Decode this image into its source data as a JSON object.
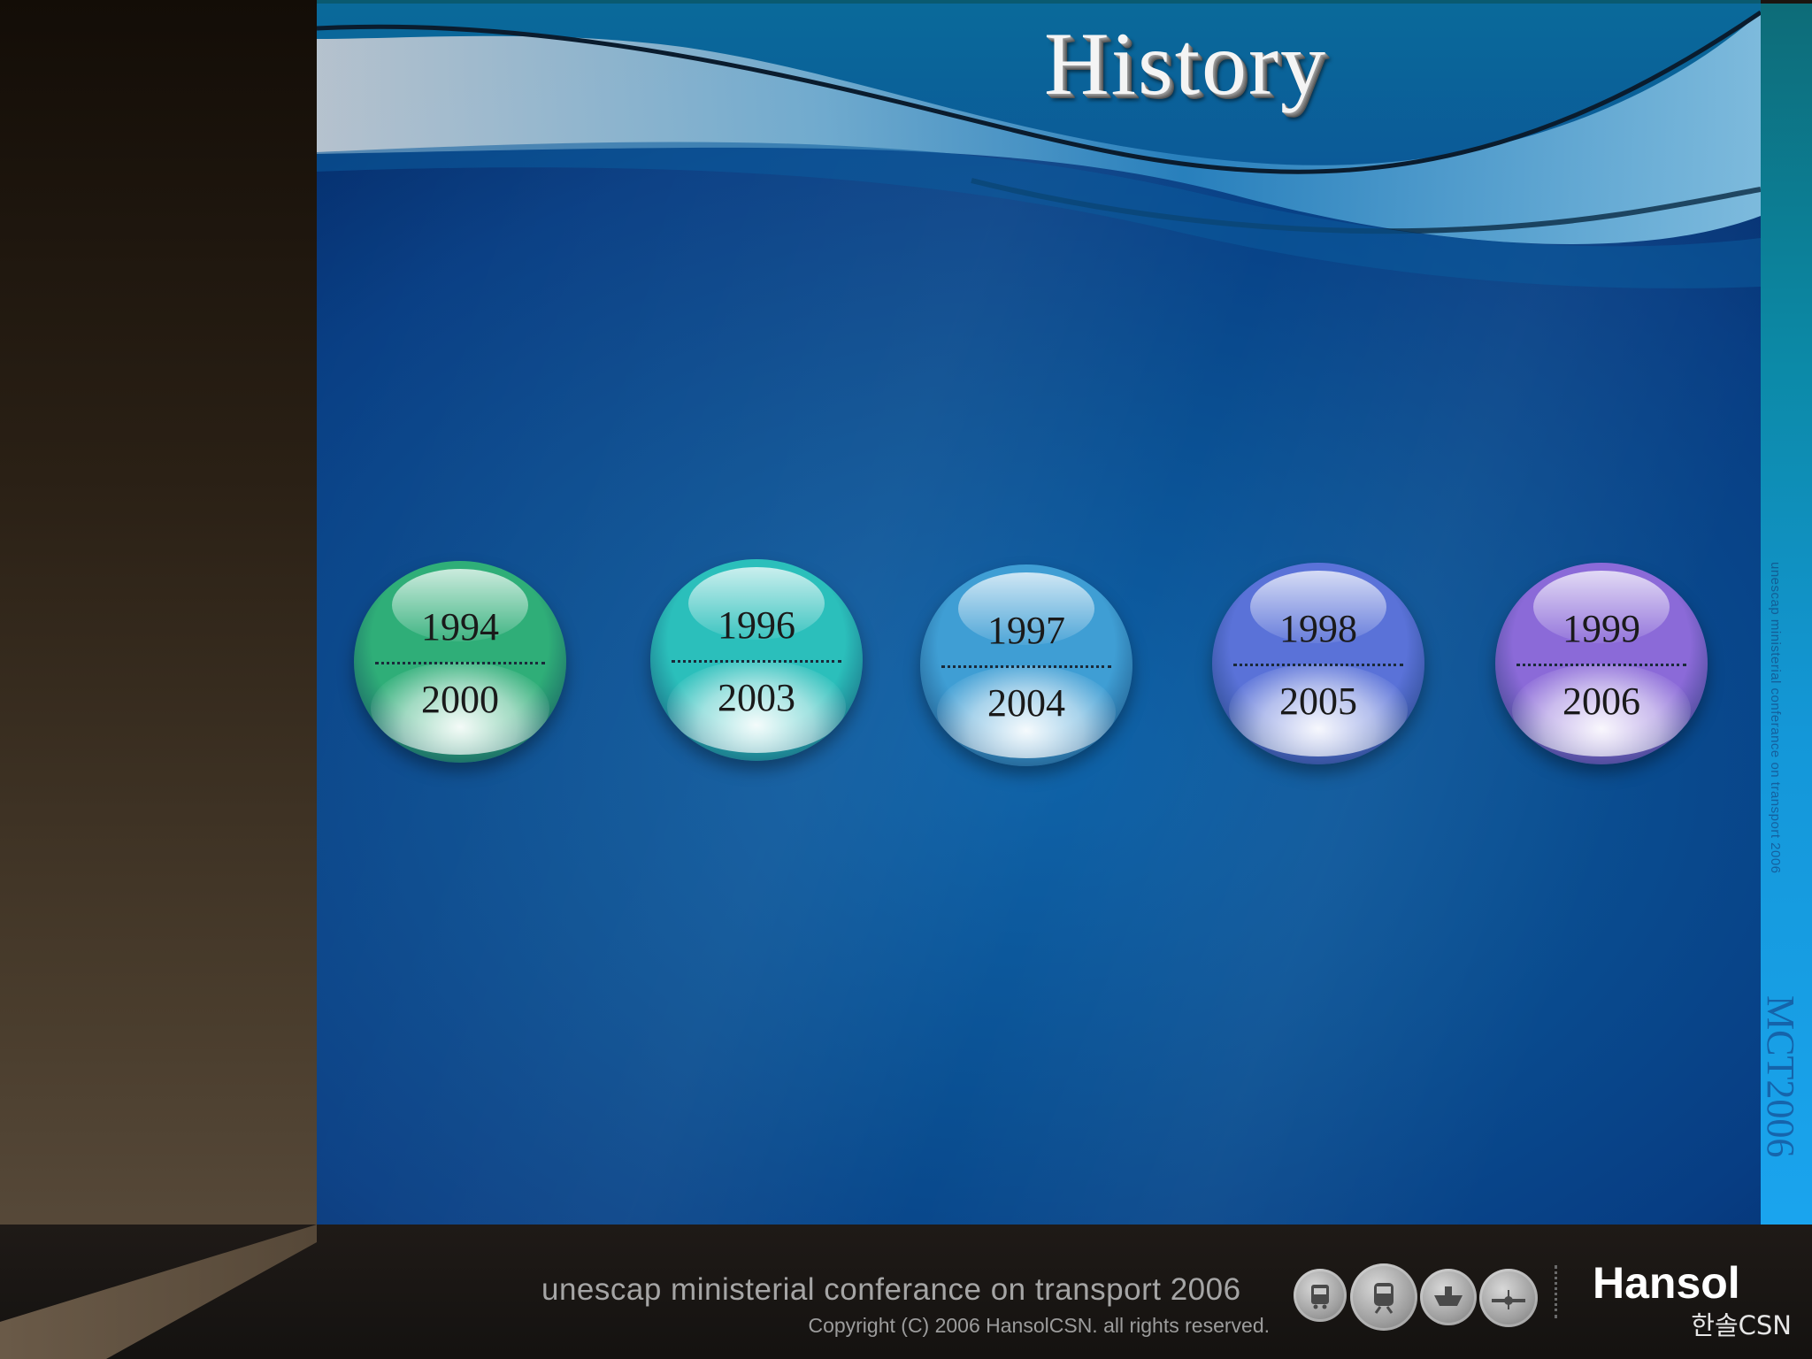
{
  "slide": {
    "title": "History"
  },
  "timeline": [
    {
      "start": "1994",
      "end": "2000",
      "color": "#2fae78"
    },
    {
      "start": "1996",
      "end": "2003",
      "color": "#2bbfbb"
    },
    {
      "start": "1997",
      "end": "2004",
      "color": "#3f9ed4"
    },
    {
      "start": "1998",
      "end": "2005",
      "color": "#5a72d8"
    },
    {
      "start": "1999",
      "end": "2006",
      "color": "#8b6ad8"
    }
  ],
  "side_text": {
    "small": "unescap ministerial conferance on transport 2006",
    "large": "MCT2006"
  },
  "footer": {
    "line1": "unescap ministerial conferance on transport 2006",
    "line2": "Copyright (C) 2006 HansolCSN. all rights reserved.",
    "icons": [
      "bus-icon",
      "train-icon",
      "ship-icon",
      "plane-icon"
    ],
    "brand": "Hansol",
    "brand_sub": "한솔CSN"
  }
}
